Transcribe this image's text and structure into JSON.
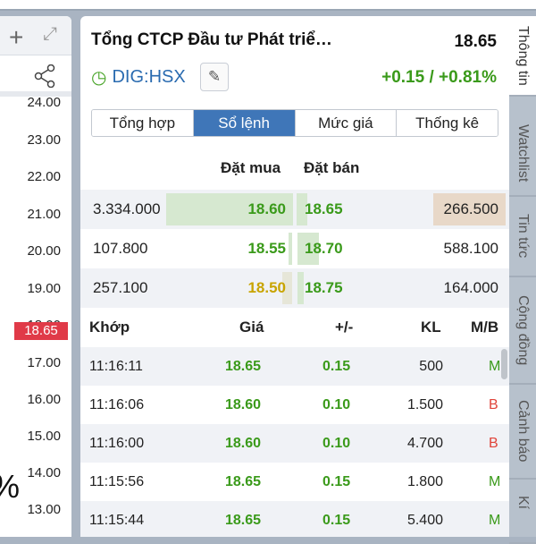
{
  "left_panel": {
    "axis": [
      "24.00",
      "23.00",
      "22.00",
      "21.00",
      "20.00",
      "19.00",
      "18.00",
      "17.00",
      "16.00",
      "15.00",
      "14.00",
      "13.00"
    ],
    "current_price": "18.65",
    "partial_text": "%"
  },
  "header": {
    "title": "Tổng CTCP Đầu tư Phát triể…",
    "price": "18.65",
    "symbol": "DIG:HSX",
    "change": "+0.15 / +0.81%"
  },
  "tabs": [
    "Tổng hợp",
    "Sổ lệnh",
    "Mức giá",
    "Thống kê"
  ],
  "orderbook": {
    "buy_header": "Đặt mua",
    "sell_header": "Đặt bán",
    "rows": [
      {
        "buy_vol": "3.334.000",
        "buy_price": "18.60",
        "sell_price": "18.65",
        "sell_vol": "266.500"
      },
      {
        "buy_vol": "107.800",
        "buy_price": "18.55",
        "sell_price": "18.70",
        "sell_vol": "588.100"
      },
      {
        "buy_vol": "257.100",
        "buy_price": "18.50",
        "sell_price": "18.75",
        "sell_vol": "164.000"
      }
    ]
  },
  "trades": {
    "headers": [
      "Khớp",
      "Giá",
      "+/-",
      "KL",
      "M/B"
    ],
    "rows": [
      {
        "time": "11:16:11",
        "price": "18.65",
        "change": "0.15",
        "vol": "500",
        "side": "M"
      },
      {
        "time": "11:16:06",
        "price": "18.60",
        "change": "0.10",
        "vol": "1.500",
        "side": "B"
      },
      {
        "time": "11:16:00",
        "price": "18.60",
        "change": "0.10",
        "vol": "4.700",
        "side": "B"
      },
      {
        "time": "11:15:56",
        "price": "18.65",
        "change": "0.15",
        "vol": "1.800",
        "side": "M"
      },
      {
        "time": "11:15:44",
        "price": "18.65",
        "change": "0.15",
        "vol": "5.400",
        "side": "M"
      }
    ]
  },
  "side_tabs": [
    "Thông tin",
    "Watchlist",
    "Tin tức",
    "Cộng đồng",
    "Cảnh báo",
    "Kí"
  ]
}
